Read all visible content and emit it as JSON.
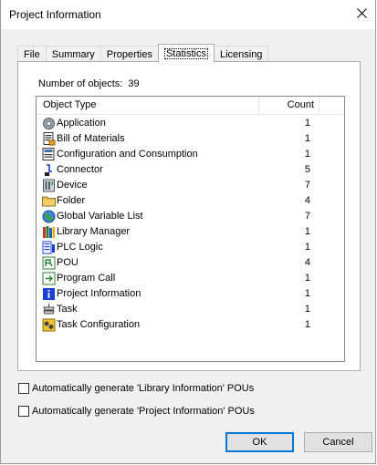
{
  "window": {
    "title": "Project Information",
    "close_glyph": "✕"
  },
  "tabs": [
    {
      "label": "File",
      "active": false
    },
    {
      "label": "Summary",
      "active": false
    },
    {
      "label": "Properties",
      "active": false
    },
    {
      "label": "Statistics",
      "active": true
    },
    {
      "label": "Licensing",
      "active": false
    }
  ],
  "statistics": {
    "count_label": "Number of objects:",
    "count_value": "39",
    "columns": {
      "type": "Object Type",
      "count": "Count"
    },
    "rows": [
      {
        "icon": "gear-icon",
        "name": "Application",
        "count": "1"
      },
      {
        "icon": "bill-of-materials-icon",
        "name": "Bill of Materials",
        "count": "1"
      },
      {
        "icon": "configuration-icon",
        "name": "Configuration and Consumption",
        "count": "1"
      },
      {
        "icon": "connector-icon",
        "name": "Connector",
        "count": "5"
      },
      {
        "icon": "device-icon",
        "name": "Device",
        "count": "7"
      },
      {
        "icon": "folder-icon",
        "name": "Folder",
        "count": "4"
      },
      {
        "icon": "globe-icon",
        "name": "Global Variable List",
        "count": "7"
      },
      {
        "icon": "library-icon",
        "name": "Library Manager",
        "count": "1"
      },
      {
        "icon": "plc-logic-icon",
        "name": "PLC Logic",
        "count": "1"
      },
      {
        "icon": "pou-icon",
        "name": "POU",
        "count": "4"
      },
      {
        "icon": "program-call-icon",
        "name": "Program Call",
        "count": "1"
      },
      {
        "icon": "info-icon",
        "name": "Project Information",
        "count": "1"
      },
      {
        "icon": "task-icon",
        "name": "Task",
        "count": "1"
      },
      {
        "icon": "task-configuration-icon",
        "name": "Task Configuration",
        "count": "1"
      }
    ]
  },
  "options": [
    {
      "label": "Automatically generate 'Library Information' POUs",
      "checked": false
    },
    {
      "label": "Automatically generate 'Project Information' POUs",
      "checked": false
    }
  ],
  "buttons": {
    "ok": "OK",
    "cancel": "Cancel"
  },
  "colors": {
    "accent": "#0078d7",
    "folder": "#e8b84a",
    "info": "#1a3fd6"
  }
}
